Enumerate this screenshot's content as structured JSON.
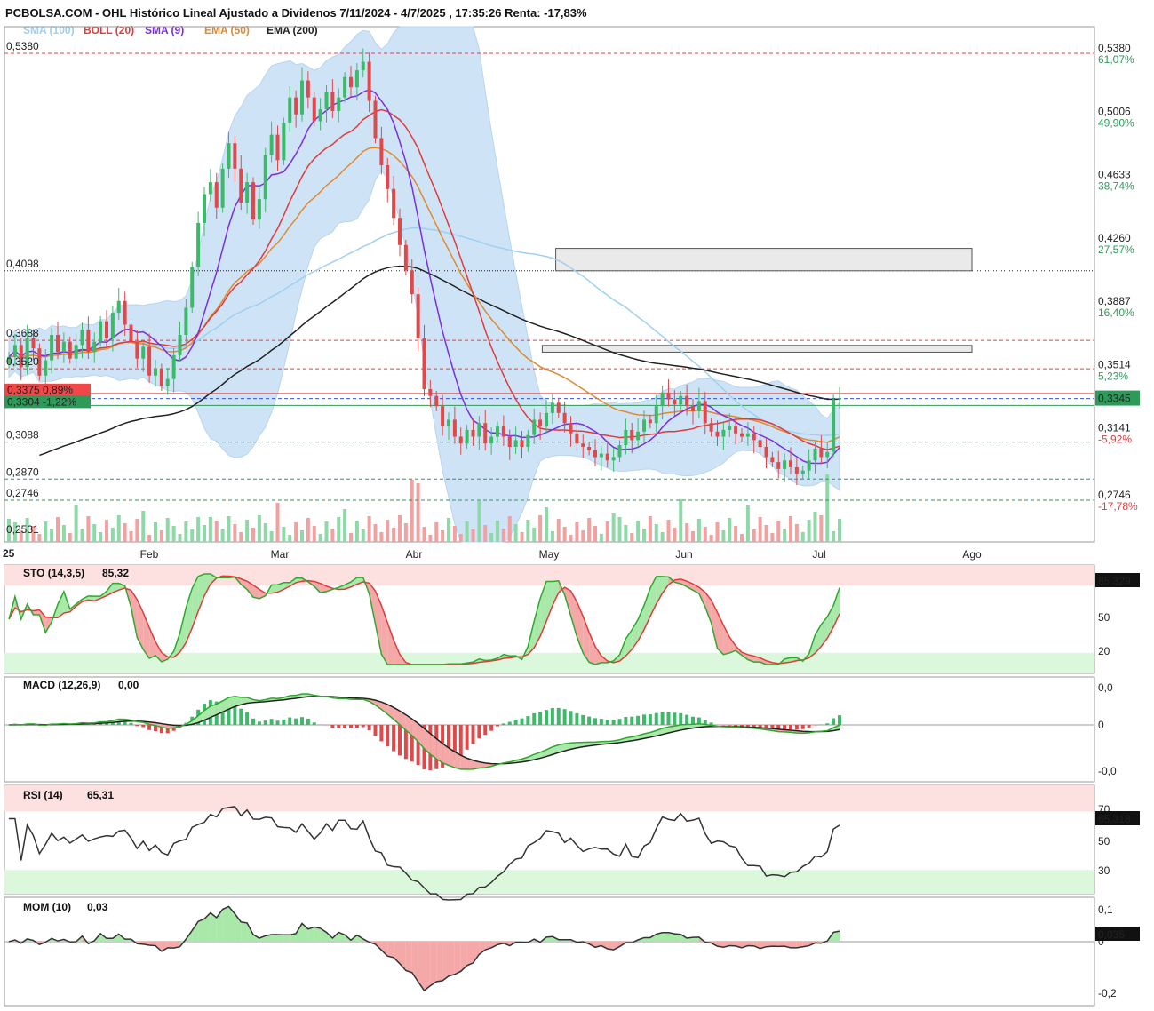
{
  "header": {
    "title": "PCBOLSA.COM - OHL Histórico Lineal Ajustado a Dividenos 7/11/2024 - 4/7/2025 , 17:35:26 Renta: -17,83%"
  },
  "legend": [
    {
      "label": "SMA (100)",
      "color": "#9fd0f0"
    },
    {
      "label": "BOLL (20)",
      "color": "#e03b3b"
    },
    {
      "label": "SMA (9)",
      "color": "#7b2fe0"
    },
    {
      "label": "EMA (50)",
      "color": "#e08a2f"
    },
    {
      "label": "EMA (200)",
      "color": "#222222"
    }
  ],
  "colors": {
    "up": "#3cba6a",
    "down": "#e0484a",
    "boll_fill": "#cfe3f7",
    "stoch_fast": "#2fa82f",
    "stoch_slow": "#e03b3b",
    "macd_line": "#2fa82f",
    "macd_signal": "#222222",
    "grid_red": "#e04040",
    "grid_green": "#2e9a5a",
    "grid_blue": "#3355dd"
  },
  "chart_data": {
    "type": "candlestick",
    "price_axis": {
      "ylim": [
        0.2531,
        0.538
      ],
      "right_labels": [
        {
          "value": "0,5380",
          "pct": "61,07%",
          "pct_color": "green"
        },
        {
          "value": "0,5006",
          "pct": "49,90%",
          "pct_color": "green"
        },
        {
          "value": "0,4633",
          "pct": "38,74%",
          "pct_color": "green"
        },
        {
          "value": "0,4260",
          "pct": "27,57%",
          "pct_color": "green"
        },
        {
          "value": "0,3887",
          "pct": "16,40%",
          "pct_color": "green"
        },
        {
          "value": "0,3514",
          "pct": "5,23%",
          "pct_color": "green"
        },
        {
          "value": "0,3141",
          "pct": "-5,92%",
          "pct_color": "red"
        },
        {
          "value": "0,2746",
          "pct": "-17,78%",
          "pct_color": "red"
        }
      ],
      "last_price": "0,3345",
      "left_labels": [
        "0,5380",
        "0,4098",
        "0,3688",
        "0,3520",
        "0,3088",
        "0,2870",
        "0,2746",
        "0,2531"
      ],
      "badge_red": "0,3375  0,89%",
      "badge_green": "0,3304  -1,22%"
    },
    "x_axis": {
      "year_label": "25",
      "months": [
        "Feb",
        "Mar",
        "Abr",
        "May",
        "Jun",
        "Jul",
        "Ago"
      ]
    },
    "reference_lines": [
      {
        "value": 0.538,
        "color": "red"
      },
      {
        "value": 0.4098,
        "color": "dotted"
      },
      {
        "value": 0.3688,
        "color": "red"
      },
      {
        "value": 0.352,
        "color": "red"
      },
      {
        "value": 0.3375,
        "color": "red_solid"
      },
      {
        "value": 0.3345,
        "color": "blue"
      },
      {
        "value": 0.3304,
        "color": "green_solid"
      },
      {
        "value": 0.3088,
        "color": "green"
      },
      {
        "value": 0.287,
        "color": "green"
      },
      {
        "value": 0.2746,
        "color": "green"
      }
    ],
    "zones": [
      {
        "from_month_pos": 3.05,
        "to_month_pos": 7.3,
        "low": 0.4098,
        "high": 0.423
      },
      {
        "from_month_pos": 2.95,
        "to_month_pos": 7.3,
        "low": 0.3618,
        "high": 0.3658
      },
      {
        "from_month_pos": 6.0,
        "to_month_pos": 7.15,
        "low": 0.304,
        "high": 0.311
      }
    ],
    "candles": {
      "start": 0.359,
      "closes_down_then_up": [
        0.359,
        0.366,
        0.353,
        0.37,
        0.364,
        0.348,
        0.357,
        0.372,
        0.362,
        0.368,
        0.358,
        0.366,
        0.375,
        0.362,
        0.368,
        0.38,
        0.37,
        0.385,
        0.392,
        0.378,
        0.368,
        0.358,
        0.365,
        0.348,
        0.352,
        0.342,
        0.346,
        0.36,
        0.372,
        0.388,
        0.412,
        0.438,
        0.455,
        0.462,
        0.447,
        0.47,
        0.485,
        0.47,
        0.45,
        0.462,
        0.44,
        0.452,
        0.478,
        0.49,
        0.475,
        0.497,
        0.512,
        0.502,
        0.522,
        0.512,
        0.498,
        0.505,
        0.515,
        0.504,
        0.512,
        0.524,
        0.518,
        0.528,
        0.533,
        0.51,
        0.488,
        0.472,
        0.458,
        0.441,
        0.425,
        0.41,
        0.396,
        0.37,
        0.34,
        0.336,
        0.33,
        0.318,
        0.322,
        0.312,
        0.308,
        0.316,
        0.312,
        0.32,
        0.308,
        0.312,
        0.318,
        0.312,
        0.306,
        0.31,
        0.306,
        0.313,
        0.322,
        0.318,
        0.326,
        0.332,
        0.326,
        0.32,
        0.314,
        0.308,
        0.306,
        0.304,
        0.3,
        0.302,
        0.298,
        0.3,
        0.307,
        0.316,
        0.31,
        0.315,
        0.322,
        0.32,
        0.33,
        0.338,
        0.334,
        0.331,
        0.336,
        0.33,
        0.327,
        0.333,
        0.32,
        0.315,
        0.312,
        0.316,
        0.318,
        0.314,
        0.312,
        0.314,
        0.31,
        0.306,
        0.3,
        0.297,
        0.293,
        0.298,
        0.294,
        0.29,
        0.292,
        0.298,
        0.305,
        0.3,
        0.303,
        0.334,
        0.3345
      ]
    }
  },
  "panels": {
    "sto": {
      "label": "STO (14,3,5)",
      "value": "85,32",
      "badge": "85,329",
      "ticks": [
        "80",
        "50",
        "20"
      ]
    },
    "macd": {
      "label": "MACD (12,26,9)",
      "value": "0,00",
      "ticks": [
        "0,0",
        "0",
        "-0,0"
      ]
    },
    "rsi": {
      "label": "RSI (14)",
      "value": "65,31",
      "badge": "65,318",
      "ticks": [
        "70",
        "50",
        "30"
      ]
    },
    "mom": {
      "label": "MOM (10)",
      "value": "0,03",
      "badge": "0,035",
      "ticks": [
        "0,1",
        "0",
        "-0,2"
      ]
    }
  }
}
